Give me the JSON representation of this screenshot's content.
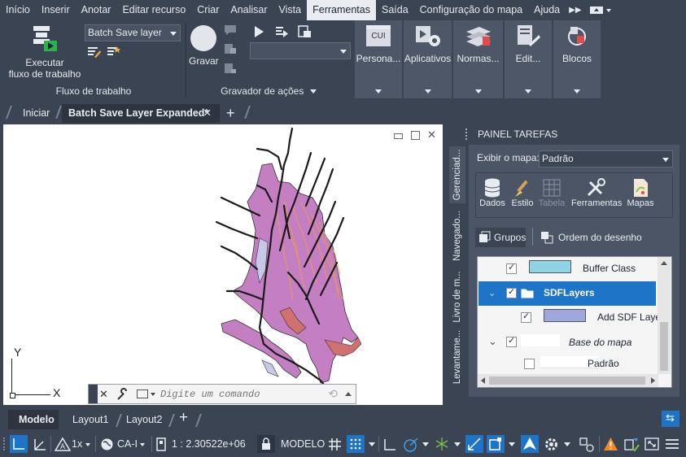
{
  "menu": {
    "items": [
      "Início",
      "Inserir",
      "Anotar",
      "Editar recurso",
      "Criar",
      "Analisar",
      "Vista",
      "Ferramentas",
      "Saída",
      "Configuração do mapa",
      "Ajuda"
    ],
    "active": "Ferramentas"
  },
  "ribbon": {
    "run_workflow_label_1": "Executar",
    "run_workflow_label_2": "fluxo de trabalho",
    "workflow_dropdown": "Batch Save layer",
    "workflow_panel_title": "Fluxo de trabalho",
    "record_label": "Gravar",
    "recorder_panel_title": "Gravador de ações",
    "custom_label": "Persona...",
    "cui_text": "CUI",
    "apps_label": "Aplicativos",
    "standards_label": "Normas...",
    "edit_label": "Edit...",
    "blocks_label": "Blocos"
  },
  "tabs": {
    "start": "Iniciar",
    "doc": "Batch Save Layer Expanded*",
    "add": "+"
  },
  "viewport": {
    "y_axis": "Y",
    "x_axis": "X"
  },
  "command": {
    "placeholder": "Digite um comando"
  },
  "taskpane": {
    "title": "PAINEL TAREFAS",
    "show_map_label": "Exibir o mapa:",
    "show_map_value": "Padrão",
    "tools": [
      "Dados",
      "Estilo",
      "Tabela",
      "Ferramentas",
      "Mapas"
    ],
    "groups_label": "Grupos",
    "draw_order_label": "Ordem do desenho",
    "vertical_tabs": [
      "Gerenciad...",
      "Navegado...",
      "Livro de m...",
      "Levantame..."
    ],
    "tree": [
      {
        "label": "Buffer Class",
        "checked": true,
        "swatch": "#8fd3e6"
      },
      {
        "label": "SDFLayers",
        "checked": true,
        "selected": true
      },
      {
        "label": "Add SDF Laye",
        "checked": true,
        "swatch": "#9fa8dc"
      },
      {
        "label": "Base do mapa",
        "checked": true,
        "italic": true
      },
      {
        "label": "Padrão",
        "checked": false
      }
    ]
  },
  "layout_tabs": [
    "Modelo",
    "Layout1",
    "Layout2"
  ],
  "status": {
    "scale_factor": "1x",
    "coord_system": "CA-I",
    "scale": "1 : 2.30522e+06",
    "model": "MODELO"
  },
  "colors": {
    "accent": "#1e74c6",
    "polygon": "#c47fc2",
    "river": "#1a1a1a",
    "orange": "#f0a040"
  }
}
